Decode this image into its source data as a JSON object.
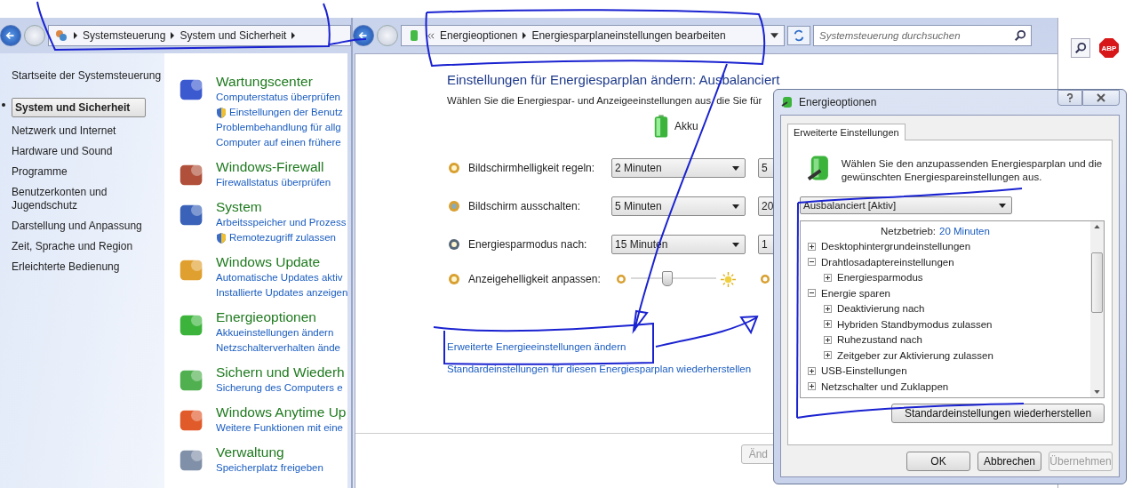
{
  "left_window": {
    "breadcrumb": [
      "Systemsteuerung",
      "System und Sicherheit"
    ],
    "sidebar": [
      {
        "label": "Startseite der Systemsteuerung",
        "selected": false
      },
      {
        "label": "System und Sicherheit",
        "selected": true
      },
      {
        "label": "Netzwerk und Internet",
        "selected": false
      },
      {
        "label": "Hardware und Sound",
        "selected": false
      },
      {
        "label": "Programme",
        "selected": false
      },
      {
        "label": "Benutzerkonten und Jugendschutz",
        "selected": false
      },
      {
        "label": "Darstellung und Anpassung",
        "selected": false
      },
      {
        "label": "Zeit, Sprache und Region",
        "selected": false
      },
      {
        "label": "Erleichterte Bedienung",
        "selected": false
      }
    ],
    "categories": [
      {
        "title": "Wartungscenter",
        "links": [
          {
            "text": "Computerstatus überprüfen",
            "shield": false
          },
          {
            "text": "Einstellungen der Benutz",
            "shield": true
          },
          {
            "text": "Problembehandlung für allg",
            "shield": false
          },
          {
            "text": "Computer auf einen frühere",
            "shield": false
          }
        ]
      },
      {
        "title": "Windows-Firewall",
        "links": [
          {
            "text": "Firewallstatus überprüfen",
            "shield": false
          }
        ]
      },
      {
        "title": "System",
        "links": [
          {
            "text": "Arbeitsspeicher und Prozess",
            "shield": false
          },
          {
            "text": "Remotezugriff zulassen",
            "shield": true
          }
        ]
      },
      {
        "title": "Windows Update",
        "links": [
          {
            "text": "Automatische Updates aktiv",
            "shield": false
          },
          {
            "text": "Installierte Updates anzeigen",
            "shield": false
          }
        ]
      },
      {
        "title": "Energieoptionen",
        "links": [
          {
            "text": "Akkueinstellungen ändern",
            "shield": false
          },
          {
            "text": "Netzschalterverhalten ände",
            "shield": false
          }
        ]
      },
      {
        "title": "Sichern und Wiederh",
        "links": [
          {
            "text": "Sicherung des Computers e",
            "shield": false
          }
        ]
      },
      {
        "title": "Windows Anytime Up",
        "links": [
          {
            "text": "Weitere Funktionen mit eine",
            "shield": false
          }
        ]
      },
      {
        "title": "Verwaltung",
        "links": [
          {
            "text": "Speicherplatz freigeben",
            "shield": false
          }
        ]
      }
    ]
  },
  "middle_window": {
    "breadcrumb": [
      "Energieoptionen",
      "Energiesparplaneinstellungen bearbeiten"
    ],
    "search": {
      "placeholder": "Systemsteuerung durchsuchen"
    },
    "heading": "Einstellungen für Energiesparplan ändern: Ausbalanciert",
    "description": "Wählen Sie die Energiespar- und Anzeigeeinstellungen aus, die Sie für",
    "column_header": "Akku",
    "settings": [
      {
        "kind": "dropdown",
        "label": "Bildschirmhelligkeit regeln:",
        "value": "2 Minuten",
        "value_2": "5"
      },
      {
        "kind": "dropdown",
        "label": "Bildschirm ausschalten:",
        "value": "5 Minuten",
        "value_2": "20"
      },
      {
        "kind": "dropdown",
        "label": "Energiesparmodus nach:",
        "value": "15 Minuten",
        "value_2": "1"
      },
      {
        "kind": "slider",
        "label": "Anzeigehelligkeit anpassen:",
        "level": 0.42
      }
    ],
    "links": [
      "Erweiterte Energieeinstellungen ändern",
      "Standardeinstellungen für diesen Energiesparplan wiederherstellen"
    ],
    "apply_button": {
      "label": "Änd",
      "disabled": true
    }
  },
  "right_window": {
    "adblock_label": "ABP"
  },
  "dialog": {
    "title": "Energieoptionen",
    "tabs": [
      {
        "label": "Erweiterte Einstellungen",
        "selected": true
      }
    ],
    "description": "Wählen Sie den anzupassenden Energiesparplan und die gewünschten Energiespareinstellungen aus.",
    "plan": "Ausbalanciert [Aktiv]",
    "tree": [
      {
        "kind": "value",
        "label": "Netzbetrieb:",
        "value": "20 Minuten"
      },
      {
        "kind": "group",
        "label": "Desktophintergrundeinstellungen",
        "expanded": false
      },
      {
        "kind": "group",
        "label": "Drahtlosadaptereinstellungen",
        "expanded": true,
        "children": [
          {
            "kind": "group",
            "label": "Energiesparmodus",
            "expanded": false
          }
        ]
      },
      {
        "kind": "group",
        "label": "Energie sparen",
        "expanded": true,
        "children": [
          {
            "kind": "group",
            "label": "Deaktivierung nach",
            "expanded": false
          },
          {
            "kind": "group",
            "label": "Hybriden Standbymodus zulassen",
            "expanded": false
          },
          {
            "kind": "group",
            "label": "Ruhezustand nach",
            "expanded": false
          },
          {
            "kind": "group",
            "label": "Zeitgeber zur Aktivierung zulassen",
            "expanded": false
          }
        ]
      },
      {
        "kind": "group",
        "label": "USB-Einstellungen",
        "expanded": false
      },
      {
        "kind": "group",
        "label": "Netzschalter und Zuklappen",
        "expanded": false
      }
    ],
    "restore_button": "Standardeinstellungen wiederherstellen",
    "buttons": [
      {
        "label": "OK",
        "disabled": false
      },
      {
        "label": "Abbrechen",
        "disabled": false
      },
      {
        "label": "Übernehmen",
        "disabled": true
      }
    ]
  }
}
